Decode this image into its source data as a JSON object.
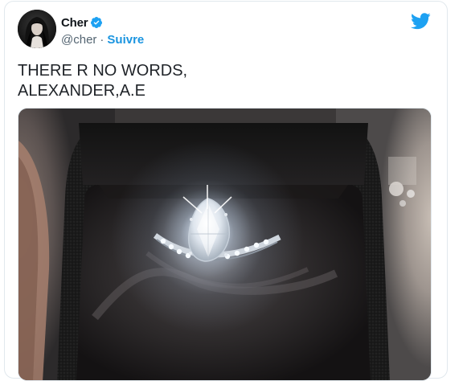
{
  "tweet": {
    "author": {
      "display_name": "Cher",
      "handle": "@cher",
      "separator": "·",
      "follow_label": "Suivre",
      "verified": true
    },
    "text": "THERE R NO WORDS,\nALEXANDER,A.E",
    "media": {
      "subject": "engagement-ring-photo"
    }
  },
  "colors": {
    "twitter_blue": "#1da1f2",
    "follow_link": "#1b95e0",
    "handle_gray": "#536471",
    "border": "#e1e8ed"
  },
  "icons": {
    "verified": "verified-badge-icon",
    "brand": "twitter-bird-icon"
  }
}
